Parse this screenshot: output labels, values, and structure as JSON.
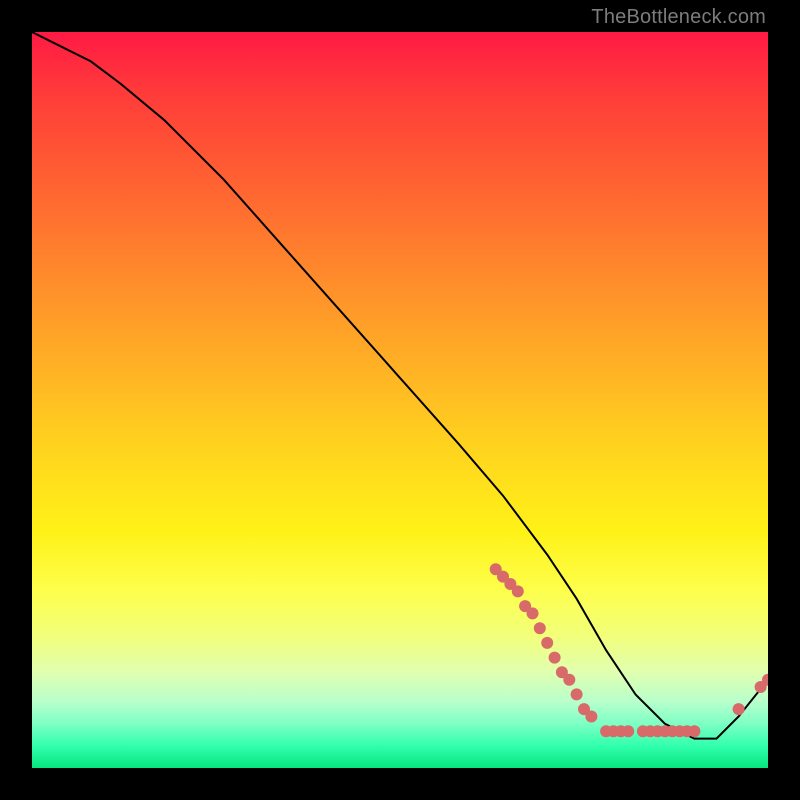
{
  "watermark": "TheBottleneck.com",
  "colors": {
    "frame_bg": "#000000",
    "dot": "#d86a6a",
    "curve": "#000000"
  },
  "chart_data": {
    "type": "line",
    "title": "",
    "xlabel": "",
    "ylabel": "",
    "xlim": [
      0,
      100
    ],
    "ylim": [
      0,
      100
    ],
    "grid": false,
    "legend": false,
    "series": [
      {
        "name": "bottleneck-curve",
        "x": [
          0,
          4,
          8,
          12,
          18,
          26,
          34,
          42,
          50,
          58,
          64,
          70,
          74,
          78,
          82,
          86,
          90,
          93,
          96,
          100
        ],
        "y": [
          100,
          98,
          96,
          93,
          88,
          80,
          71,
          62,
          53,
          44,
          37,
          29,
          23,
          16,
          10,
          6,
          4,
          4,
          7,
          12
        ]
      }
    ],
    "scatter_points": [
      {
        "x": 63,
        "y": 27
      },
      {
        "x": 64,
        "y": 26
      },
      {
        "x": 65,
        "y": 25
      },
      {
        "x": 66,
        "y": 24
      },
      {
        "x": 67,
        "y": 22
      },
      {
        "x": 68,
        "y": 21
      },
      {
        "x": 69,
        "y": 19
      },
      {
        "x": 70,
        "y": 17
      },
      {
        "x": 71,
        "y": 15
      },
      {
        "x": 72,
        "y": 13
      },
      {
        "x": 73,
        "y": 12
      },
      {
        "x": 74,
        "y": 10
      },
      {
        "x": 75,
        "y": 8
      },
      {
        "x": 76,
        "y": 7
      },
      {
        "x": 78,
        "y": 5
      },
      {
        "x": 79,
        "y": 5
      },
      {
        "x": 80,
        "y": 5
      },
      {
        "x": 81,
        "y": 5
      },
      {
        "x": 83,
        "y": 5
      },
      {
        "x": 84,
        "y": 5
      },
      {
        "x": 85,
        "y": 5
      },
      {
        "x": 86,
        "y": 5
      },
      {
        "x": 87,
        "y": 5
      },
      {
        "x": 88,
        "y": 5
      },
      {
        "x": 89,
        "y": 5
      },
      {
        "x": 90,
        "y": 5
      },
      {
        "x": 96,
        "y": 8
      },
      {
        "x": 99,
        "y": 11
      },
      {
        "x": 100,
        "y": 12
      }
    ]
  }
}
